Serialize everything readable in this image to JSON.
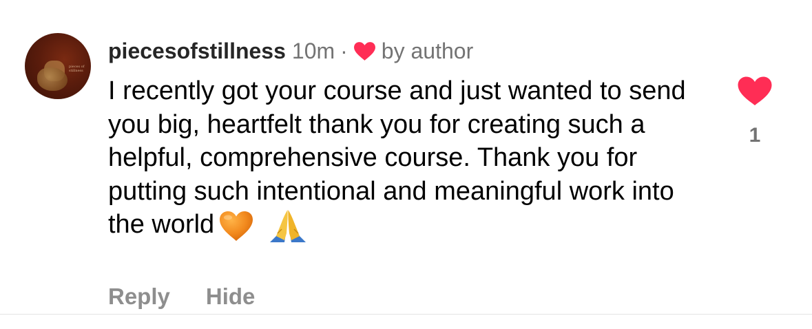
{
  "comment": {
    "avatar": {
      "label": "pieces of stillness"
    },
    "username": "piecesofstillness",
    "time": "10m",
    "separator": "·",
    "liked_by": "by author",
    "liked_by_icon": "red-heart-icon",
    "text": "I recently got your course and just wanted to send you big, heartfelt thank you for creating such a helpful, comprehensive course. Thank you for putting such intentional and meaningful work into the world",
    "emojis": [
      "orange-heart-emoji",
      "folded-hands-emoji"
    ],
    "actions": {
      "reply": "Reply",
      "hide": "Hide"
    },
    "like": {
      "icon": "red-heart-icon",
      "count": "1",
      "liked": true
    },
    "colors": {
      "like_red": "#ff2d55",
      "meta_gray": "#737373",
      "action_gray": "#8e8e8e",
      "orange_heart": "#f28a1e"
    }
  }
}
